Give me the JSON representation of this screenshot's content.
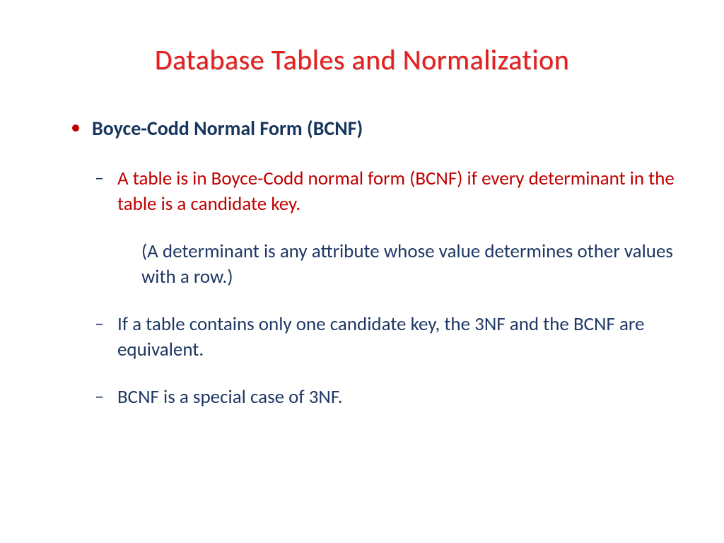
{
  "slide": {
    "title": "Database Tables and Normalization",
    "heading": "Boyce-Codd Normal Form (BCNF)",
    "point1": "A table is in Boyce-Codd normal form (BCNF) if every determinant in the table is a candidate key.",
    "note": "(A determinant is any attribute whose value determines other values with a row.)",
    "point2": "If a table contains only one candidate key, the 3NF and the BCNF are equivalent.",
    "point3": "BCNF is a special case of 3NF."
  }
}
